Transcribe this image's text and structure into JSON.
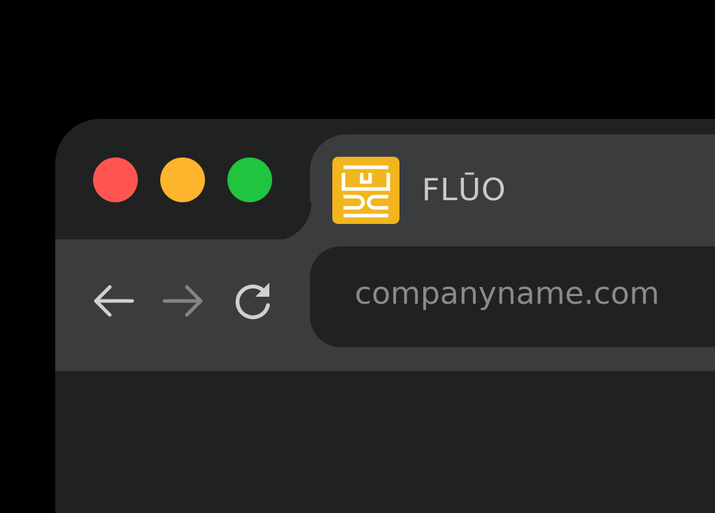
{
  "window": {
    "controls": {
      "close_color": "#FF5551",
      "minimize_color": "#FEB42C",
      "maximize_color": "#21C43F"
    }
  },
  "tab": {
    "title": "FLŪO",
    "favicon": {
      "icon": "fluo-logo-icon",
      "background": "#F2B51F",
      "foreground": "#FFFFFF"
    }
  },
  "toolbar": {
    "back_icon": "arrow-left-icon",
    "forward_icon": "arrow-right-icon",
    "reload_icon": "reload-icon",
    "address": "companyname.com"
  }
}
